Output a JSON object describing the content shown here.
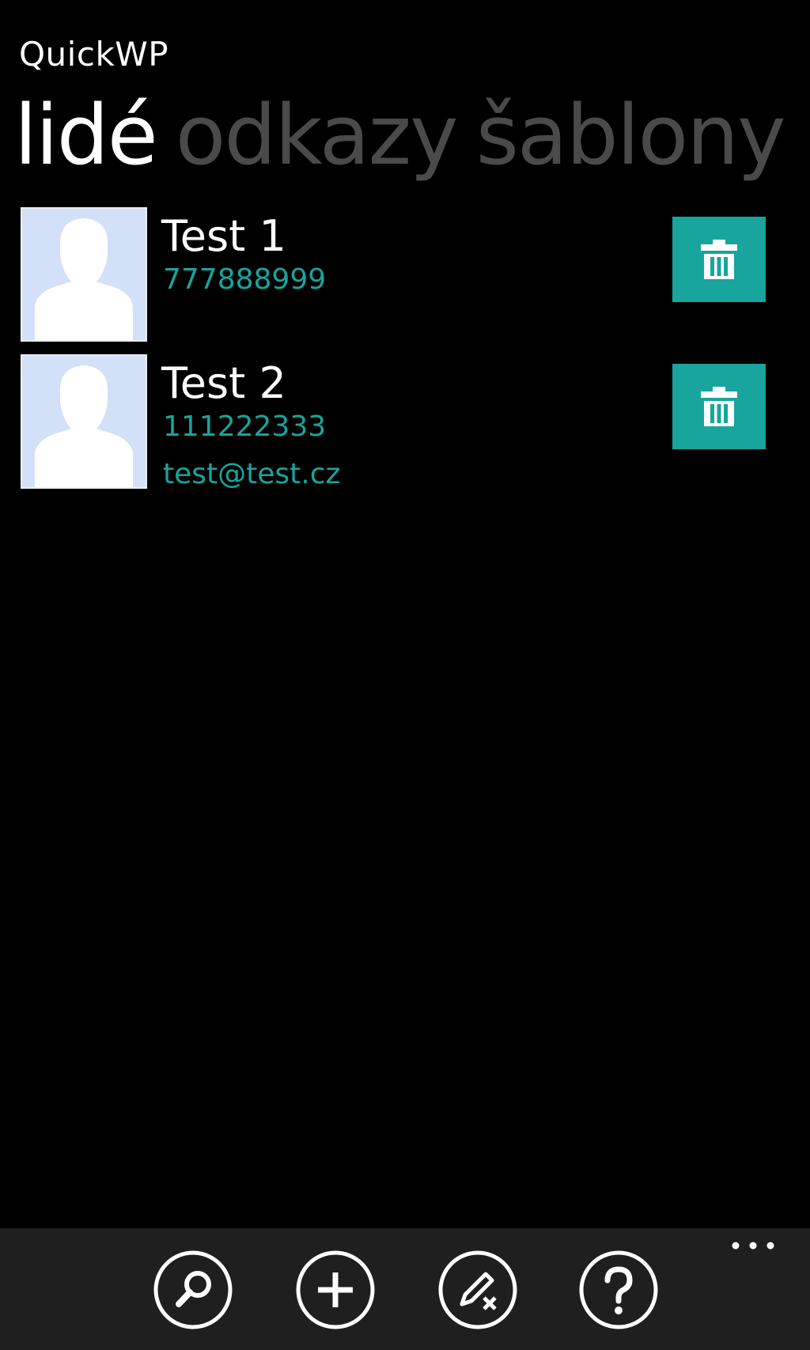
{
  "app": {
    "title": "QuickWP"
  },
  "pivot": {
    "items": [
      {
        "label": "lidé",
        "active": true
      },
      {
        "label": "odkazy",
        "active": false
      },
      {
        "label": "šablony",
        "active": false
      }
    ]
  },
  "contacts": [
    {
      "name": "Test 1",
      "phone": "777888999",
      "email": ""
    },
    {
      "name": "Test 2",
      "phone": "111222333",
      "email": "test@test.cz"
    }
  ],
  "icons": {
    "avatar": "person-silhouette-icon",
    "delete": "trash-icon",
    "appbar": [
      "search-icon",
      "add-icon",
      "edit-clear-icon",
      "help-icon"
    ],
    "more": "more-dots-icon"
  },
  "colors": {
    "accent": "#17a59d",
    "background": "#000000",
    "appbar_background": "#1f1f1f",
    "inactive_pivot": "#4a4a4a",
    "avatar_background": "#d2e1f7"
  }
}
